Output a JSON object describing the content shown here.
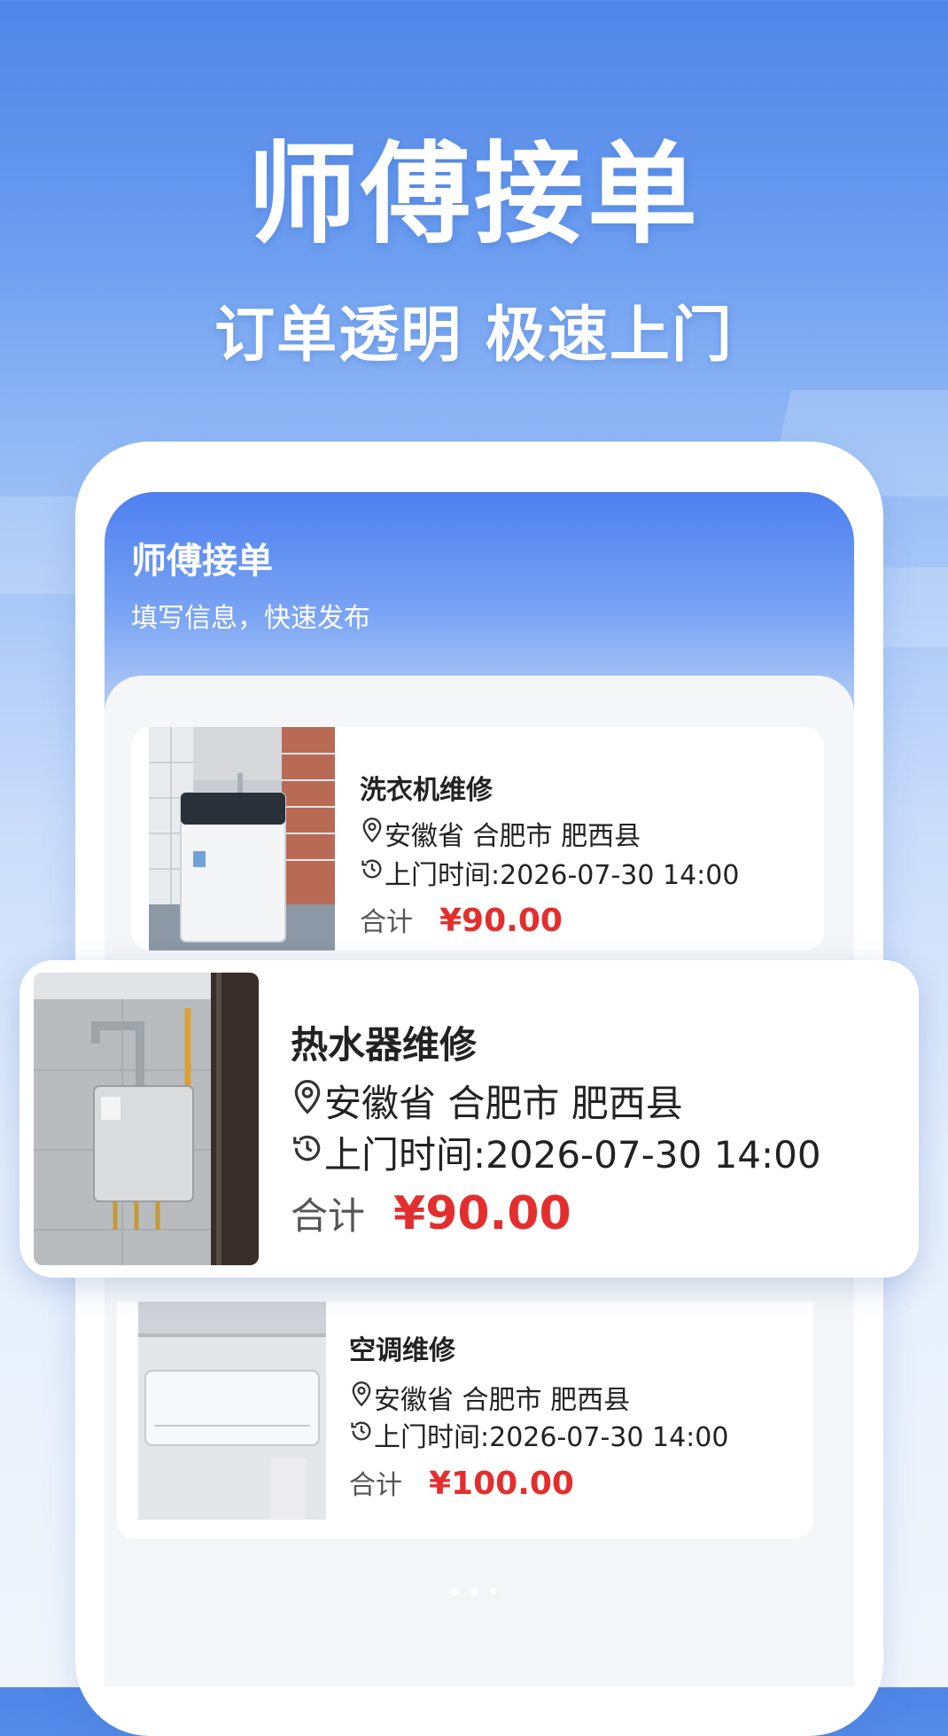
{
  "hero": {
    "title": "师傅接单",
    "subtitle": "订单透明 极速上门"
  },
  "app": {
    "title": "师傅接单",
    "subtitle": "填写信息，快速发布"
  },
  "orders": [
    {
      "name": "洗衣机维修",
      "address": "安徽省 合肥市 肥西县",
      "time": "上门时间:2026-07-30 14:00",
      "total_label": "合计",
      "price": "¥90.00",
      "image": "washing-machine-photo"
    },
    {
      "name": "热水器维修",
      "address": "安徽省 合肥市 肥西县",
      "time": "上门时间:2026-07-30 14:00",
      "total_label": "合计",
      "price": "¥90.00",
      "image": "water-heater-photo"
    },
    {
      "name": "空调维修",
      "address": "安徽省 合肥市 肥西县",
      "time": "上门时间:2026-07-30 14:00",
      "total_label": "合计",
      "price": "¥100.00",
      "image": "air-conditioner-photo"
    }
  ],
  "colors": {
    "primary_blue": "#4d7ff0",
    "price_red": "#e42e2e"
  }
}
